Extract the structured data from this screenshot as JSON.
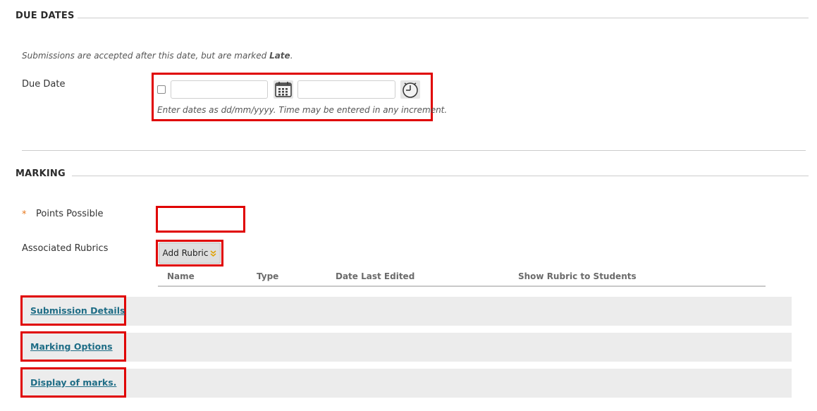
{
  "due_dates": {
    "title": "DUE DATES",
    "instruction_before": "Submissions are accepted after this date, but are marked",
    "instruction_bold": "Late",
    "instruction_after": ".",
    "due_date_label": "Due Date",
    "date_value": "",
    "time_value": "",
    "format_help": "Enter dates as dd/mm/yyyy. Time may be entered in any increment.",
    "calendar_icon": "calendar-icon",
    "clock_icon": "clock-icon"
  },
  "marking": {
    "title": "MARKING",
    "required_marker": "*",
    "points_label": "Points Possible",
    "points_value": "",
    "rubrics_label": "Associated Rubrics",
    "add_rubric_label": "Add Rubric",
    "rubric_table_headers": [
      "Name",
      "Type",
      "Date Last Edited",
      "Show Rubric to Students"
    ]
  },
  "sections": [
    {
      "label": "Submission Details"
    },
    {
      "label": "Marking Options"
    },
    {
      "label": "Display of marks."
    }
  ],
  "colors": {
    "highlight": "#e00000",
    "link": "#1f6d86",
    "required": "#e8781e",
    "band": "#ececec"
  }
}
